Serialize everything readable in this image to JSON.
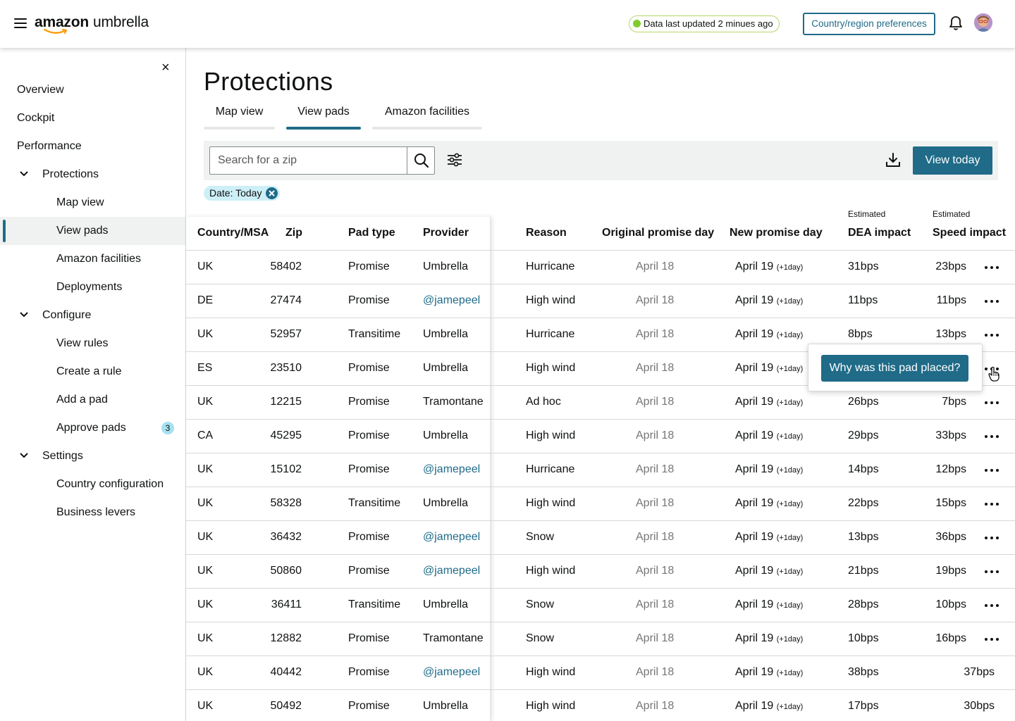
{
  "header": {
    "brand": "amazon",
    "product": "umbrella",
    "status_text": "Data last updated 2 minues ago",
    "preferences_label": "Country/region preferences"
  },
  "sidebar": {
    "close_glyph": "×",
    "items": [
      {
        "label": "Overview"
      },
      {
        "label": "Cockpit"
      },
      {
        "label": "Performance"
      },
      {
        "label": "Protections",
        "expanded": true
      },
      {
        "label": "Map view"
      },
      {
        "label": "View pads",
        "selected": true
      },
      {
        "label": "Amazon facilities"
      },
      {
        "label": "Deployments"
      },
      {
        "label": "Configure",
        "expanded": true
      },
      {
        "label": "View rules"
      },
      {
        "label": "Create a rule"
      },
      {
        "label": "Add a pad"
      },
      {
        "label": "Approve pads",
        "badge": "3"
      },
      {
        "label": "Settings",
        "expanded": true
      },
      {
        "label": "Country configuration"
      },
      {
        "label": "Business levers"
      }
    ]
  },
  "main": {
    "title": "Protections",
    "tabs": [
      {
        "label": "Map view"
      },
      {
        "label": "View pads",
        "active": true
      },
      {
        "label": "Amazon facilities"
      }
    ],
    "search": {
      "placeholder": "Search for a zip"
    },
    "view_today_label": "View today",
    "filter_chip": "Date:  Today"
  },
  "table": {
    "estimated_label": "Estimated",
    "columns": [
      "Country/MSA",
      "Zip",
      "Pad type",
      "Provider",
      "Reason",
      "Original promise day",
      "New promise day",
      "DEA impact",
      "Speed impact"
    ],
    "day_suffix": "(+1day)",
    "rows": [
      {
        "country": "UK",
        "zip": "58402",
        "pad_type": "Promise",
        "provider": "Umbrella",
        "reason": "Hurricane",
        "orig": "April 18",
        "new": "April 19",
        "dea": "31bps",
        "speed": "23bps"
      },
      {
        "country": "DE",
        "zip": "27474",
        "pad_type": "Promise",
        "provider": "@jamepeel",
        "reason": "High wind",
        "orig": "April 18",
        "new": "April 19",
        "dea": "11bps",
        "speed": "11bps"
      },
      {
        "country": "UK",
        "zip": "52957",
        "pad_type": "Transitime",
        "provider": "Umbrella",
        "reason": "Hurricane",
        "orig": "April 18",
        "new": "April 19",
        "dea": "8bps",
        "speed": "13bps"
      },
      {
        "country": "ES",
        "zip": "23510",
        "pad_type": "Promise",
        "provider": "Umbrella",
        "reason": "High wind",
        "orig": "April 18",
        "new": "April 19",
        "dea": "",
        "speed": ""
      },
      {
        "country": "UK",
        "zip": "12215",
        "pad_type": "Promise",
        "provider": "Tramontane",
        "reason": "Ad hoc",
        "orig": "April 18",
        "new": "April 19",
        "dea": "26bps",
        "speed": "7bps"
      },
      {
        "country": "CA",
        "zip": "45295",
        "pad_type": "Promise",
        "provider": "Umbrella",
        "reason": "High wind",
        "orig": "April 18",
        "new": "April 19",
        "dea": "29bps",
        "speed": "33bps"
      },
      {
        "country": "UK",
        "zip": "15102",
        "pad_type": "Promise",
        "provider": "@jamepeel",
        "reason": "Hurricane",
        "orig": "April 18",
        "new": "April 19",
        "dea": "14bps",
        "speed": "12bps"
      },
      {
        "country": "UK",
        "zip": "58328",
        "pad_type": "Transitime",
        "provider": "Umbrella",
        "reason": "High wind",
        "orig": "April 18",
        "new": "April 19",
        "dea": "22bps",
        "speed": "15bps"
      },
      {
        "country": "UK",
        "zip": "36432",
        "pad_type": "Promise",
        "provider": "@jamepeel",
        "reason": "Snow",
        "orig": "April 18",
        "new": "April 19",
        "dea": "13bps",
        "speed": "36bps"
      },
      {
        "country": "UK",
        "zip": "50860",
        "pad_type": "Promise",
        "provider": "@jamepeel",
        "reason": "High wind",
        "orig": "April 18",
        "new": "April 19",
        "dea": "21bps",
        "speed": "19bps"
      },
      {
        "country": "UK",
        "zip": "36411",
        "pad_type": "Transitime",
        "provider": "Umbrella",
        "reason": "Snow",
        "orig": "April 18",
        "new": "April 19",
        "dea": "28bps",
        "speed": "10bps"
      },
      {
        "country": "UK",
        "zip": "12882",
        "pad_type": "Promise",
        "provider": "Tramontane",
        "reason": "Snow",
        "orig": "April 18",
        "new": "April 19",
        "dea": "10bps",
        "speed": "16bps"
      },
      {
        "country": "UK",
        "zip": "40442",
        "pad_type": "Promise",
        "provider": "@jamepeel",
        "reason": "High wind",
        "orig": "April 18",
        "new": "April 19",
        "dea": "38bps",
        "speed": "37bps"
      },
      {
        "country": "UK",
        "zip": "50492",
        "pad_type": "Promise",
        "provider": "Umbrella",
        "reason": "High wind",
        "orig": "April 18",
        "new": "April 19",
        "dea": "17bps",
        "speed": "30bps"
      }
    ],
    "popover_label": "Why was this pad placed?"
  },
  "colors": {
    "accent": "#1f6b88",
    "status_green": "#7fcc2c",
    "chip_bg": "#cdeff7"
  },
  "icons": [
    "menu-icon",
    "bell-icon",
    "avatar",
    "close-icon",
    "chevron-down-icon",
    "search-icon",
    "filter-icon",
    "download-icon",
    "more-icon",
    "hand-cursor-icon"
  ]
}
